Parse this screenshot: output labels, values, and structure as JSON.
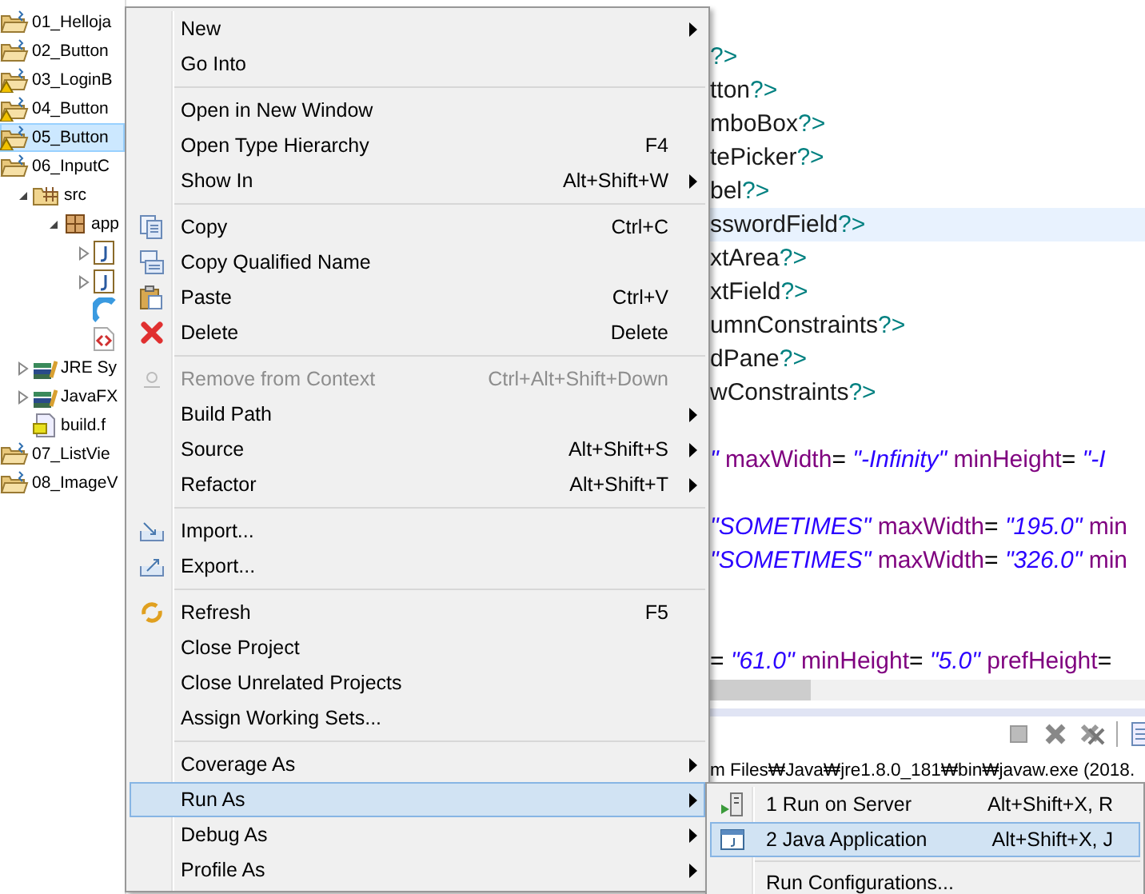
{
  "project_tree": {
    "items": [
      {
        "kind": "project",
        "label": "01_Helloja",
        "warning": false,
        "selected": false
      },
      {
        "kind": "project",
        "label": "02_Button",
        "warning": false,
        "selected": false
      },
      {
        "kind": "project",
        "label": "03_LoginB",
        "warning": true,
        "selected": false
      },
      {
        "kind": "project",
        "label": "04_Button",
        "warning": true,
        "selected": false
      },
      {
        "kind": "project",
        "label": "05_Button",
        "warning": true,
        "selected": true
      },
      {
        "kind": "project",
        "label": "06_InputC",
        "warning": false,
        "selected": false,
        "children": [
          {
            "kind": "source",
            "label": "src",
            "expanded": true,
            "selected": false,
            "children": [
              {
                "kind": "package",
                "label": "app",
                "expanded": true,
                "selected": false,
                "children": [
                  {
                    "kind": "java",
                    "expanded": false,
                    "selected": false
                  },
                  {
                    "kind": "java",
                    "expanded": false,
                    "selected": false
                  },
                  {
                    "kind": "css",
                    "selected": false
                  },
                  {
                    "kind": "fxml",
                    "selected": false
                  }
                ]
              }
            ]
          },
          {
            "kind": "library",
            "label": "JRE Sy",
            "expanded": false,
            "selected": false
          },
          {
            "kind": "library",
            "label": "JavaFX",
            "expanded": false,
            "selected": false
          },
          {
            "kind": "build",
            "label": "build.f",
            "selected": false
          }
        ]
      },
      {
        "kind": "project",
        "label": "07_ListVie",
        "warning": false,
        "selected": false
      },
      {
        "kind": "project",
        "label": "08_ImageV",
        "warning": false,
        "selected": false
      }
    ]
  },
  "editor": {
    "lines": [
      {
        "kind": "blank"
      },
      {
        "kind": "code",
        "current": false,
        "segments": [
          {
            "kind": "pi",
            "text": "?>"
          }
        ]
      },
      {
        "kind": "code",
        "current": false,
        "segments": [
          {
            "kind": "tag",
            "text": "tton"
          },
          {
            "kind": "pi",
            "text": "?>"
          }
        ]
      },
      {
        "kind": "code",
        "current": false,
        "segments": [
          {
            "kind": "tag",
            "text": "mboBox"
          },
          {
            "kind": "pi",
            "text": "?>"
          }
        ]
      },
      {
        "kind": "code",
        "current": false,
        "segments": [
          {
            "kind": "tag",
            "text": "tePicker"
          },
          {
            "kind": "pi",
            "text": "?>"
          }
        ]
      },
      {
        "kind": "code",
        "current": false,
        "segments": [
          {
            "kind": "tag",
            "text": "bel"
          },
          {
            "kind": "pi",
            "text": "?>"
          }
        ]
      },
      {
        "kind": "code",
        "current": true,
        "segments": [
          {
            "kind": "tag",
            "text": "sswordField"
          },
          {
            "kind": "pi",
            "text": "?>"
          }
        ]
      },
      {
        "kind": "code",
        "current": false,
        "segments": [
          {
            "kind": "tag",
            "text": "xtArea"
          },
          {
            "kind": "pi",
            "text": "?>"
          }
        ]
      },
      {
        "kind": "code",
        "current": false,
        "segments": [
          {
            "kind": "tag",
            "text": "xtField"
          },
          {
            "kind": "pi",
            "text": "?>"
          }
        ]
      },
      {
        "kind": "code",
        "current": false,
        "segments": [
          {
            "kind": "tag",
            "text": "umnConstraints"
          },
          {
            "kind": "pi",
            "text": "?>"
          }
        ]
      },
      {
        "kind": "code",
        "current": false,
        "segments": [
          {
            "kind": "tag",
            "text": "dPane"
          },
          {
            "kind": "pi",
            "text": "?>"
          }
        ]
      },
      {
        "kind": "code",
        "current": false,
        "segments": [
          {
            "kind": "tag",
            "text": "wConstraints"
          },
          {
            "kind": "pi",
            "text": "?>"
          }
        ]
      },
      {
        "kind": "blank"
      },
      {
        "kind": "code",
        "current": false,
        "segments": [
          {
            "kind": "value",
            "text": "\""
          },
          {
            "kind": "attr",
            "text": "maxWidth"
          },
          {
            "kind": "eq",
            "text": "="
          },
          {
            "kind": "value",
            "text": "\"-Infinity\""
          },
          {
            "kind": "attr",
            "text": "minHeight"
          },
          {
            "kind": "eq",
            "text": "="
          },
          {
            "kind": "value",
            "text": "\"-I"
          }
        ]
      },
      {
        "kind": "blank"
      },
      {
        "kind": "code",
        "current": false,
        "segments": [
          {
            "kind": "value",
            "text": "\"SOMETIMES\""
          },
          {
            "kind": "attr",
            "text": "maxWidth"
          },
          {
            "kind": "eq",
            "text": "="
          },
          {
            "kind": "value",
            "text": "\"195.0\""
          },
          {
            "kind": "attr",
            "text": "min"
          }
        ]
      },
      {
        "kind": "code",
        "current": false,
        "segments": [
          {
            "kind": "value",
            "text": "\"SOMETIMES\""
          },
          {
            "kind": "attr",
            "text": "maxWidth"
          },
          {
            "kind": "eq",
            "text": "="
          },
          {
            "kind": "value",
            "text": "\"326.0\""
          },
          {
            "kind": "attr",
            "text": "min"
          }
        ]
      },
      {
        "kind": "blank"
      },
      {
        "kind": "blank"
      },
      {
        "kind": "code",
        "current": false,
        "segments": [
          {
            "kind": "eq",
            "text": "="
          },
          {
            "kind": "value",
            "text": "\"61.0\""
          },
          {
            "kind": "attr",
            "text": "minHeight"
          },
          {
            "kind": "eq",
            "text": "="
          },
          {
            "kind": "value",
            "text": "\"5.0\""
          },
          {
            "kind": "attr",
            "text": "prefHeight"
          },
          {
            "kind": "eq",
            "text": "="
          }
        ]
      }
    ]
  },
  "console": {
    "text": "m Files₩Java₩jre1.8.0_181₩bin₩javaw.exe (2018."
  },
  "context_menu": {
    "items": [
      {
        "kind": "item",
        "label": "New",
        "submenu": true,
        "disabled": false,
        "selected": false
      },
      {
        "kind": "item",
        "label": "Go Into",
        "submenu": false,
        "disabled": false,
        "selected": false
      },
      {
        "kind": "separator"
      },
      {
        "kind": "item",
        "label": "Open in New Window",
        "submenu": false,
        "disabled": false,
        "selected": false
      },
      {
        "kind": "item",
        "label": "Open Type Hierarchy",
        "shortcut": "F4",
        "submenu": false,
        "disabled": false,
        "selected": false
      },
      {
        "kind": "item",
        "label": "Show In",
        "shortcut": "Alt+Shift+W",
        "submenu": true,
        "disabled": false,
        "selected": false
      },
      {
        "kind": "separator"
      },
      {
        "kind": "item",
        "label": "Copy",
        "shortcut": "Ctrl+C",
        "submenu": false,
        "disabled": false,
        "selected": false
      },
      {
        "kind": "item",
        "label": "Copy Qualified Name",
        "submenu": false,
        "disabled": false,
        "selected": false
      },
      {
        "kind": "item",
        "label": "Paste",
        "shortcut": "Ctrl+V",
        "submenu": false,
        "disabled": false,
        "selected": false
      },
      {
        "kind": "item",
        "label": "Delete",
        "shortcut": "Delete",
        "submenu": false,
        "disabled": false,
        "selected": false
      },
      {
        "kind": "separator"
      },
      {
        "kind": "item",
        "label": "Remove from Context",
        "shortcut": "Ctrl+Alt+Shift+Down",
        "submenu": false,
        "disabled": true,
        "selected": false
      },
      {
        "kind": "item",
        "label": "Build Path",
        "submenu": true,
        "disabled": false,
        "selected": false
      },
      {
        "kind": "item",
        "label": "Source",
        "shortcut": "Alt+Shift+S",
        "submenu": true,
        "disabled": false,
        "selected": false
      },
      {
        "kind": "item",
        "label": "Refactor",
        "shortcut": "Alt+Shift+T",
        "submenu": true,
        "disabled": false,
        "selected": false
      },
      {
        "kind": "separator"
      },
      {
        "kind": "item",
        "label": "Import...",
        "submenu": false,
        "disabled": false,
        "selected": false
      },
      {
        "kind": "item",
        "label": "Export...",
        "submenu": false,
        "disabled": false,
        "selected": false
      },
      {
        "kind": "separator"
      },
      {
        "kind": "item",
        "label": "Refresh",
        "shortcut": "F5",
        "submenu": false,
        "disabled": false,
        "selected": false
      },
      {
        "kind": "item",
        "label": "Close Project",
        "submenu": false,
        "disabled": false,
        "selected": false
      },
      {
        "kind": "item",
        "label": "Close Unrelated Projects",
        "submenu": false,
        "disabled": false,
        "selected": false
      },
      {
        "kind": "item",
        "label": "Assign Working Sets...",
        "submenu": false,
        "disabled": false,
        "selected": false
      },
      {
        "kind": "separator"
      },
      {
        "kind": "item",
        "label": "Coverage As",
        "submenu": true,
        "disabled": false,
        "selected": false
      },
      {
        "kind": "item",
        "label": "Run As",
        "submenu": true,
        "disabled": false,
        "selected": true
      },
      {
        "kind": "item",
        "label": "Debug As",
        "submenu": true,
        "disabled": false,
        "selected": false
      },
      {
        "kind": "item",
        "label": "Profile As",
        "submenu": true,
        "disabled": false,
        "selected": false
      }
    ]
  },
  "run_as_submenu": {
    "items": [
      {
        "kind": "item",
        "label": "1 Run on Server",
        "shortcut": "Alt+Shift+X, R",
        "selected": false
      },
      {
        "kind": "item",
        "label": "2 Java Application",
        "shortcut": "Alt+Shift+X, J",
        "selected": true
      },
      {
        "kind": "separator"
      },
      {
        "kind": "item",
        "label": "Run Configurations...",
        "selected": false
      }
    ]
  }
}
